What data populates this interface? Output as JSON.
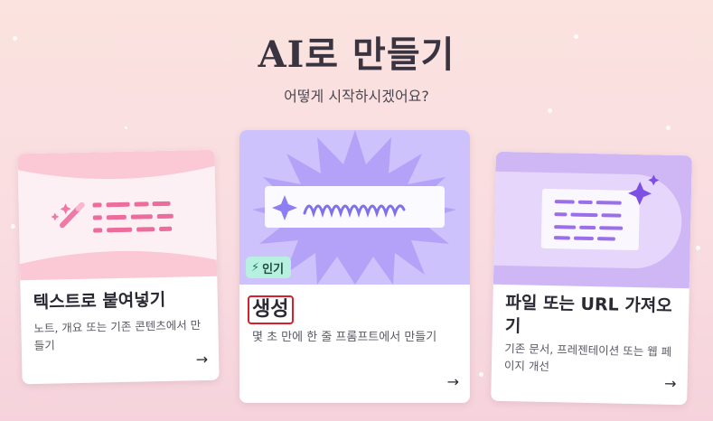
{
  "header": {
    "title": "AI로 만들기",
    "subtitle": "어떻게 시작하시겠어요?"
  },
  "cards": [
    {
      "title": "텍스트로 붙여넣기",
      "description": "노트, 개요 또는 기존 콘텐츠에서 만들기",
      "arrow": "→"
    },
    {
      "badge": "인기",
      "title": "생성",
      "description": "몇 초 만에 한 줄 프롬프트에서 만들기",
      "arrow": "→"
    },
    {
      "title": "파일 또는 URL 가져오기",
      "description": "기존 문서, 프레젠테이션 또는 웹 페이지 개선",
      "arrow": "→"
    }
  ],
  "colors": {
    "background": "#fbe3df",
    "card1_art": "#fbc9d5",
    "card2_art": "#cdc2fb",
    "card3_art": "#cfb7f6",
    "badge_bg": "#b8f0df",
    "highlight_border": "#d8202c"
  },
  "icons": {
    "card1": "magic-wand-icon",
    "card2": "sparkle-icon",
    "card3": "sparkle-icon",
    "badge": "lightning-icon",
    "arrow": "arrow-right-icon"
  }
}
